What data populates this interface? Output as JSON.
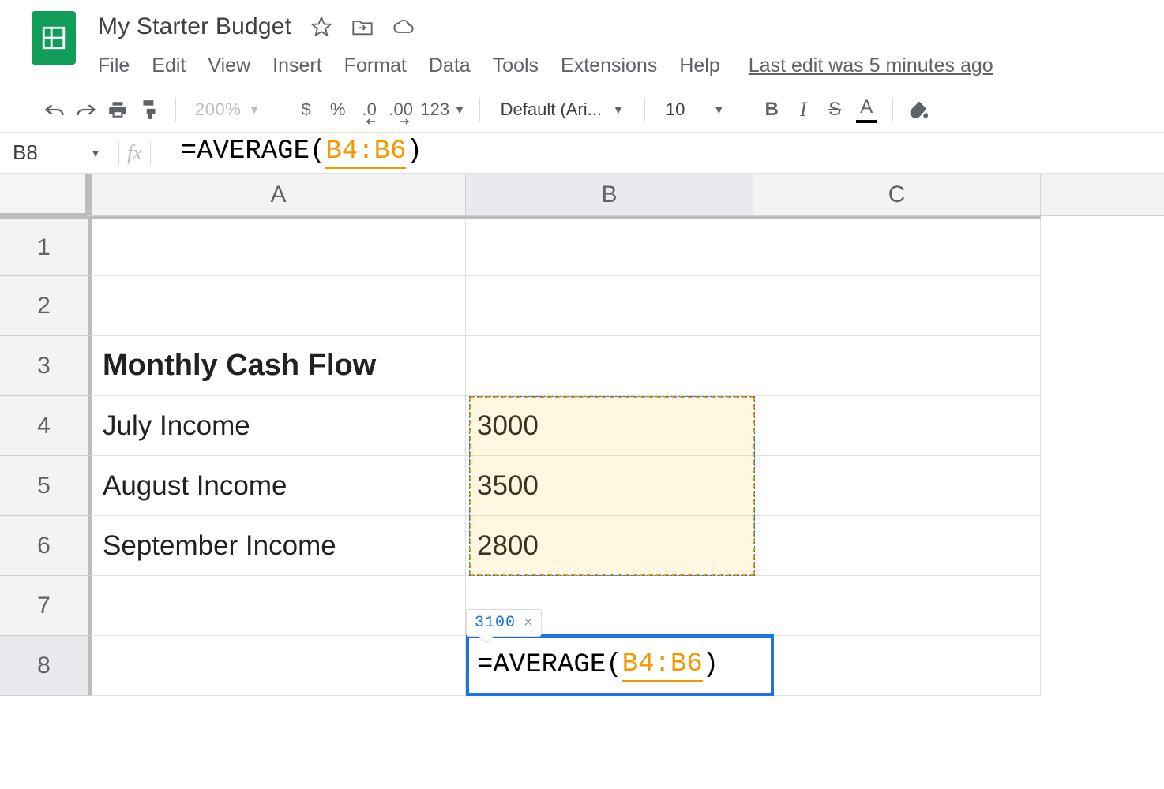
{
  "doc_title": "My Starter Budget",
  "menubar": {
    "file": "File",
    "edit": "Edit",
    "view": "View",
    "insert": "Insert",
    "format": "Format",
    "data": "Data",
    "tools": "Tools",
    "extensions": "Extensions",
    "help": "Help"
  },
  "last_edit": "Last edit was 5 minutes ago",
  "toolbar": {
    "zoom": "200%",
    "currency": "$",
    "percent": "%",
    "dec_decrease": ".0",
    "dec_increase": ".00",
    "more_formats": "123",
    "font_name": "Default (Ari...",
    "font_size": "10",
    "bold": "B",
    "italic": "I",
    "strike": "S",
    "text_color": "A"
  },
  "name_box": "B8",
  "fx_label": "fx",
  "formula": {
    "prefix": "=AVERAGE(",
    "range": "B4:B6",
    "suffix": ")"
  },
  "columns": {
    "A": "A",
    "B": "B",
    "C": "C"
  },
  "rows": {
    "1": "1",
    "2": "2",
    "3": "3",
    "4": "4",
    "5": "5",
    "6": "6",
    "7": "7",
    "8": "8"
  },
  "sheet": {
    "A3": "Monthly Cash Flow",
    "A4": "July Income",
    "B4": "3000",
    "A5": "August Income",
    "B5": "3500",
    "A6": "September Income",
    "B6": "2800"
  },
  "editing": {
    "prefix": "=AVERAGE(",
    "range": "B4:B6",
    "suffix": ")"
  },
  "preview": {
    "value": "3100",
    "close": "×"
  }
}
